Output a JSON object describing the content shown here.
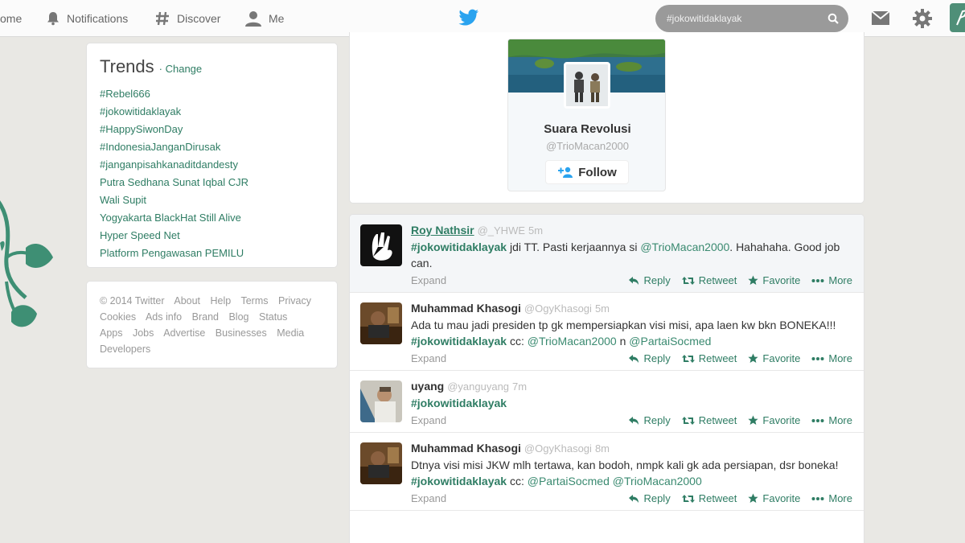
{
  "topbar": {
    "nav": [
      {
        "label": "ome"
      },
      {
        "label": "Notifications"
      },
      {
        "label": "Discover"
      },
      {
        "label": "Me"
      }
    ],
    "search_value": "#jokowitidaklayak"
  },
  "colors": {
    "accent": "#2f7d64",
    "twitter_blue": "#2aa3ef",
    "page_bg": "#e9e8e4"
  },
  "trends": {
    "title": "Trends",
    "change_label": "· Change",
    "items": [
      "#Rebel666",
      "#jokowitidaklayak",
      "#HappySiwonDay",
      "#IndonesiaJanganDirusak",
      "#janganpisahkanaditdandesty",
      "Putra Sedhana Sunat Iqbal CJR",
      "Wali Supit",
      "Yogyakarta BlackHat Still Alive",
      "Hyper Speed Net",
      "Platform Pengawasan PEMILU"
    ]
  },
  "footer_links": [
    "© 2014 Twitter",
    "About",
    "Help",
    "Terms",
    "Privacy",
    "Cookies",
    "Ads info",
    "Brand",
    "Blog",
    "Status",
    "Apps",
    "Jobs",
    "Advertise",
    "Businesses",
    "Media",
    "Developers"
  ],
  "profile": {
    "name": "Suara Revolusi",
    "handle": "@TrioMacan2000",
    "follow_label": "Follow"
  },
  "tweet_actions": {
    "expand": "Expand",
    "reply": "Reply",
    "retweet": "Retweet",
    "favorite": "Favorite",
    "more": "More"
  },
  "tweets": [
    {
      "name": "Roy Nathsir",
      "username": "@_YHWE",
      "time": "5m",
      "parts": [
        {
          "k": "tag",
          "t": "#jokowitidaklayak"
        },
        {
          "k": "txt",
          "t": " jdi TT. Pasti kerjaannya si "
        },
        {
          "k": "mention",
          "t": "@TrioMacan2000"
        },
        {
          "k": "txt",
          "t": ". Hahahaha. Good job can."
        }
      ]
    },
    {
      "name": "Muhammad Khasogi",
      "username": "@OgyKhasogi",
      "time": "5m",
      "parts": [
        {
          "k": "txt",
          "t": "Ada tu mau jadi presiden tp gk mempersiapkan visi misi, apa laen kw bkn BONEKA!!! "
        },
        {
          "k": "tag",
          "t": "#jokowitidaklayak"
        },
        {
          "k": "txt",
          "t": " cc: "
        },
        {
          "k": "mention",
          "t": "@TrioMacan2000"
        },
        {
          "k": "txt",
          "t": " n "
        },
        {
          "k": "mention",
          "t": "@PartaiSocmed"
        }
      ]
    },
    {
      "name": "uyang",
      "username": "@yanguyang",
      "time": "7m",
      "parts": [
        {
          "k": "tag",
          "t": "#jokowitidaklayak"
        }
      ]
    },
    {
      "name": "Muhammad Khasogi",
      "username": "@OgyKhasogi",
      "time": "8m",
      "parts": [
        {
          "k": "txt",
          "t": "Dtnya visi misi JKW mlh tertawa, kan bodoh, nmpk kali gk ada persiapan, dsr boneka! "
        },
        {
          "k": "tag",
          "t": "#jokowitidaklayak"
        },
        {
          "k": "txt",
          "t": " cc: "
        },
        {
          "k": "mention",
          "t": "@PartaiSocmed"
        },
        {
          "k": "txt",
          "t": " "
        },
        {
          "k": "mention",
          "t": "@TrioMacan2000"
        }
      ]
    }
  ]
}
